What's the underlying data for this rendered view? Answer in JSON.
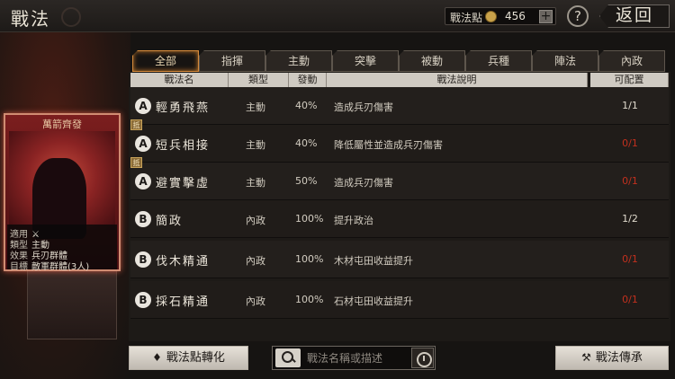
{
  "header": {
    "title": "戰法",
    "points_label": "戰法點",
    "points_value": "456",
    "plus": "+",
    "help": "?",
    "back": "返回"
  },
  "card": {
    "name": "萬箭齊發",
    "rows": [
      {
        "key": "適用",
        "value": ""
      },
      {
        "key": "類型",
        "value": "主動"
      },
      {
        "key": "效果",
        "value": "兵刃群體"
      },
      {
        "key": "目標",
        "value": "敵軍群體(3人)"
      }
    ]
  },
  "tabs": [
    "全部",
    "指揮",
    "主動",
    "突擊",
    "被動",
    "兵種",
    "陣法",
    "內政"
  ],
  "table": {
    "headers": [
      "戰法名",
      "類型",
      "發動",
      "戰法說明",
      "可配置"
    ],
    "rows": [
      {
        "grade": "A",
        "tag": "",
        "name": "輕勇飛燕",
        "type": "主動",
        "rate": "40%",
        "desc": "造成兵刃傷害",
        "avail": "1/1",
        "red": false
      },
      {
        "grade": "A",
        "tag": "抵",
        "name": "短兵相接",
        "type": "主動",
        "rate": "40%",
        "desc": "降低屬性並造成兵刃傷害",
        "avail": "0/1",
        "red": true
      },
      {
        "grade": "A",
        "tag": "抵",
        "name": "避實擊虛",
        "type": "主動",
        "rate": "50%",
        "desc": "造成兵刃傷害",
        "avail": "0/1",
        "red": true
      },
      {
        "grade": "B",
        "tag": "",
        "name": "簡政",
        "type": "內政",
        "rate": "100%",
        "desc": "提升政治",
        "avail": "1/2",
        "red": false
      },
      {
        "grade": "B",
        "tag": "",
        "name": "伐木精通",
        "type": "內政",
        "rate": "100%",
        "desc": "木材屯田收益提升",
        "avail": "0/1",
        "red": true
      },
      {
        "grade": "B",
        "tag": "",
        "name": "採石精通",
        "type": "內政",
        "rate": "100%",
        "desc": "石材屯田收益提升",
        "avail": "0/1",
        "red": true
      }
    ]
  },
  "footer": {
    "convert_label": "戰法點轉化",
    "search_placeholder": "戰法名稱或描述",
    "inherit_label": "戰法傳承"
  },
  "colors": {
    "accent": "#d48a3c",
    "unavailable": "#c2301e"
  }
}
